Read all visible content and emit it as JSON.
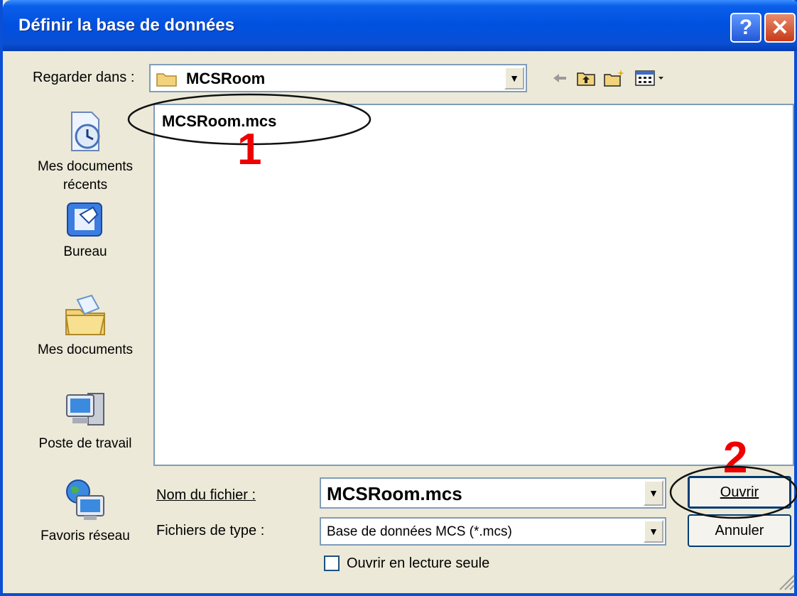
{
  "window": {
    "title": "Définir la base de données",
    "help_icon": "help-icon",
    "close_icon": "close-icon"
  },
  "look_in": {
    "label": "Regarder dans :",
    "value": "MCSRoom",
    "toolbar_icons": [
      "back-arrow-icon",
      "up-folder-icon",
      "new-folder-icon",
      "view-menu-icon"
    ]
  },
  "places": [
    {
      "label": "Mes documents récents",
      "icon": "recent-documents-icon"
    },
    {
      "label": "Bureau",
      "icon": "desktop-icon"
    },
    {
      "label": "Mes documents",
      "icon": "my-documents-icon"
    },
    {
      "label": "Poste de travail",
      "icon": "my-computer-icon"
    },
    {
      "label": "Favoris réseau",
      "icon": "network-places-icon"
    }
  ],
  "files": [
    {
      "name": "MCSRoom.mcs"
    }
  ],
  "file_name": {
    "label": "Nom du fichier :",
    "value": "MCSRoom.mcs"
  },
  "file_type": {
    "label": "Fichiers de type :",
    "value": "Base de données MCS (*.mcs)"
  },
  "buttons": {
    "open": "Ouvrir",
    "cancel": "Annuler"
  },
  "read_only": {
    "label": "Ouvrir en lecture seule",
    "checked": false
  },
  "annotations": {
    "step1": "1",
    "step2": "2",
    "color": "#e00000"
  },
  "colors": {
    "titlebar": "#0a4fd4",
    "dialog_bg": "#ece9d8",
    "button_border": "#003c74"
  }
}
